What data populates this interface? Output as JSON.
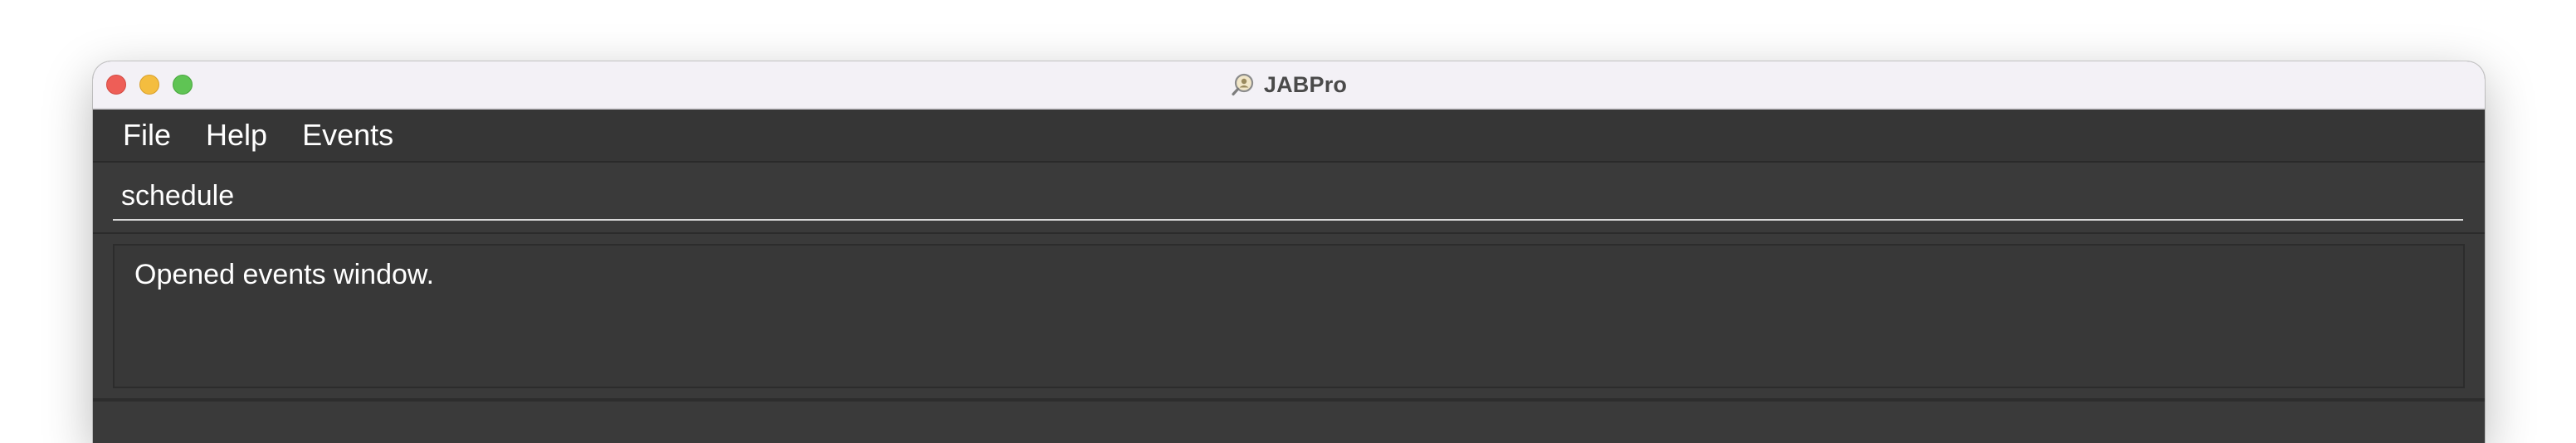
{
  "window": {
    "title": "JABPro",
    "app_icon": "magnifier-user-icon"
  },
  "menu": {
    "items": [
      {
        "label": "File"
      },
      {
        "label": "Help"
      },
      {
        "label": "Events"
      }
    ]
  },
  "command_box": {
    "value": "schedule"
  },
  "result_display": {
    "message": "Opened events window."
  },
  "colors": {
    "titlebar_bg": "#f3f1f6",
    "app_bg": "#3a3a3a",
    "text": "#ffffff",
    "close": "#ee5e57",
    "minimize": "#f4bd3f",
    "maximize": "#5fc454"
  }
}
